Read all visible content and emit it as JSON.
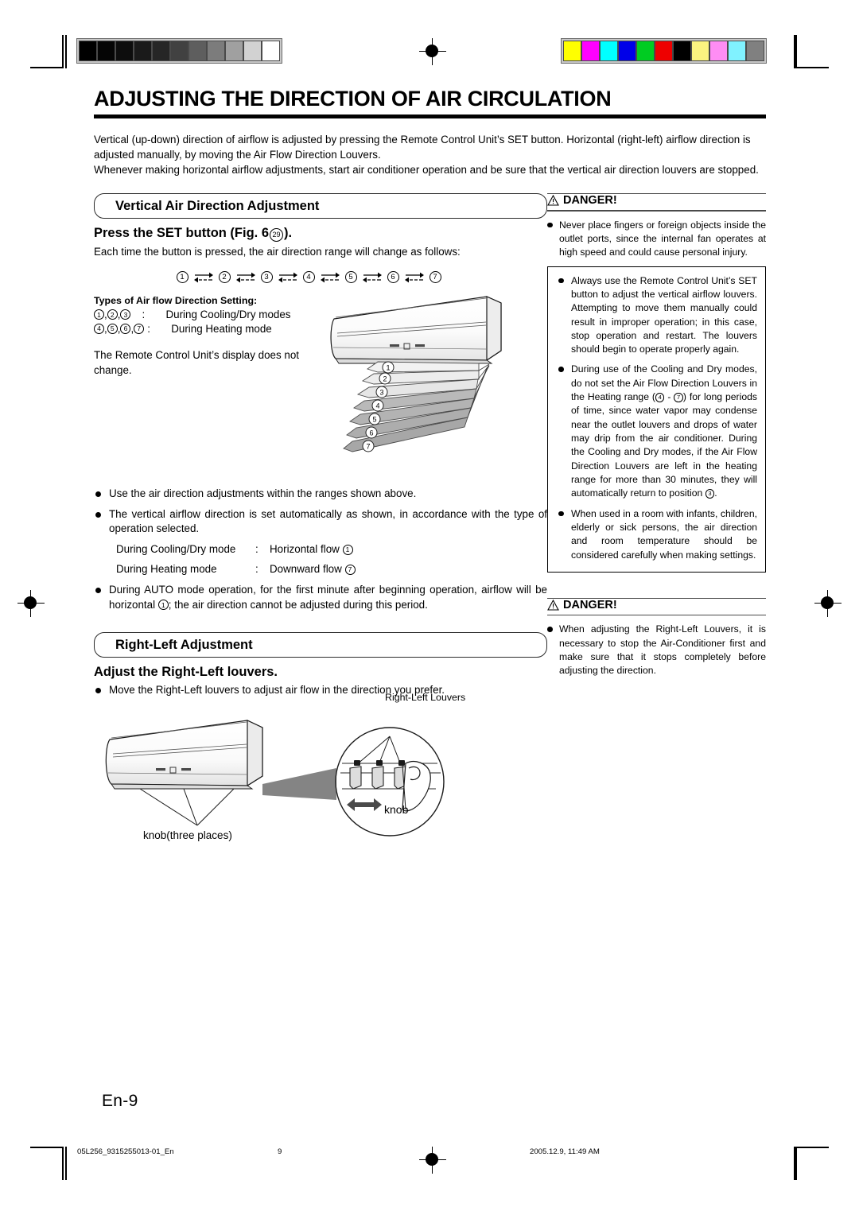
{
  "document": {
    "title": "ADJUSTING THE DIRECTION OF AIR CIRCULATION",
    "intro": "Vertical (up-down) direction of airflow is adjusted by pressing the Remote Control Unit’s SET button. Horizontal (right-left) airflow direction is adjusted manually, by moving the Air Flow Direction Louvers.\nWhenever making horizontal airflow adjustments, start air conditioner operation and be sure that the vertical air direction louvers are stopped.",
    "page_label": "En-9"
  },
  "vertical_section": {
    "banner": "Vertical Air Direction Adjustment",
    "heading_pre": "Press the SET button (Fig. 6 ",
    "heading_circled": "29",
    "heading_post": ").",
    "lead": "Each time the button is pressed, the air direction range will change as follows:",
    "sequence": [
      "1",
      "2",
      "3",
      "4",
      "5",
      "6",
      "7"
    ],
    "types": {
      "title": "Types of Air flow Direction Setting:",
      "rows": [
        {
          "nums": [
            "1",
            "2",
            "3"
          ],
          "separator": ":",
          "label": "During Cooling/Dry modes"
        },
        {
          "nums": [
            "4",
            "5",
            "6",
            "7"
          ],
          "separator": ":",
          "label": "During Heating mode"
        }
      ],
      "note": "The Remote Control Unit’s display does not change."
    },
    "figure": {
      "name": "air-conditioner-vertical-airflow-diagram",
      "layer_labels": [
        "1",
        "2",
        "3",
        "4",
        "5",
        "6",
        "7"
      ],
      "cooling_layers": [
        "1",
        "2",
        "3"
      ],
      "heating_layers": [
        "4",
        "5",
        "6",
        "7"
      ]
    },
    "bullets": [
      "Use the air direction adjustments within the ranges shown above.",
      "The vertical airflow direction is set automatically as shown, in accordance with the type of operation selected."
    ],
    "mode_rows": [
      {
        "label": "During Cooling/Dry mode",
        "separator": ":",
        "value": "Horizontal flow ",
        "circled": "1"
      },
      {
        "label": "During Heating mode",
        "separator": ":",
        "value": "Downward flow ",
        "circled": "7"
      }
    ],
    "bullet_auto_a": "During AUTO mode operation, for the first minute after beginning operation, airflow will be horizontal ",
    "bullet_auto_circled": "1",
    "bullet_auto_b": "; the air direction cannot be adjusted during this period."
  },
  "danger_1": {
    "icon": "warning-triangle-icon",
    "title": "DANGER!",
    "bullet_outer": "Never place fingers or foreign objects inside the outlet ports, since the internal fan operates at high speed and could cause personal injury.",
    "inner_bullets": [
      {
        "text_a": "Always use the Remote Control Unit’s SET button to adjust the vertical airflow louvers. Attempting to move them manually could result in improper operation; in this case, stop operation and restart. The louvers should begin to operate properly again."
      },
      {
        "text_a": "During use of the Cooling and Dry modes, do not set the Air Flow Direction Louvers in the Heating range (",
        "circled_1": "4",
        "text_b": " - ",
        "circled_2": "7",
        "text_c": ") for long periods of time, since water vapor may condense near the outlet louvers and drops of water may drip from the air conditioner. During the Cooling and Dry modes, if the Air Flow Direction Louvers are left in the heating range for more than 30 minutes, they will automatically return to position ",
        "circled_3": "3",
        "text_d": "."
      },
      {
        "text_a": "When used in a room with infants, children, elderly or sick persons, the air direction and room temperature should be considered carefully when making settings."
      }
    ]
  },
  "rightleft_section": {
    "banner": "Right-Left Adjustment",
    "heading": "Adjust the Right-Left louvers.",
    "bullet": "Move the Right-Left louvers to adjust air flow in the direction you prefer.",
    "figure": {
      "name": "right-left-louvers-diagram",
      "callout_louvers": "Right-Left Louvers",
      "callout_knob": "knob",
      "callout_knob_three": "knob(three places)"
    }
  },
  "danger_2": {
    "icon": "warning-triangle-icon",
    "title": "DANGER!",
    "bullet": "When adjusting the Right-Left Louvers, it is necessary to stop the Air-Conditioner first and make sure that it stops completely before adjusting the direction."
  },
  "footer": {
    "file": "05L256_9315255013-01_En",
    "page": "9",
    "date": "2005.12.9, 11:49 AM"
  },
  "calibration": {
    "grayscale_patches": [
      "#000000",
      "#050505",
      "#0d0d0d",
      "#1a1a1a",
      "#262626",
      "#414141",
      "#5e5e5e",
      "#7c7c7c",
      "#a0a0a0",
      "#d2d2d2",
      "#ffffff"
    ],
    "color_patches": [
      "#ffff00",
      "#ff00ff",
      "#00ffff",
      "#0000e8",
      "#00cc22",
      "#ee0000",
      "#000000",
      "#fbf380",
      "#ff8df4",
      "#80f2ff",
      "#808080"
    ]
  }
}
